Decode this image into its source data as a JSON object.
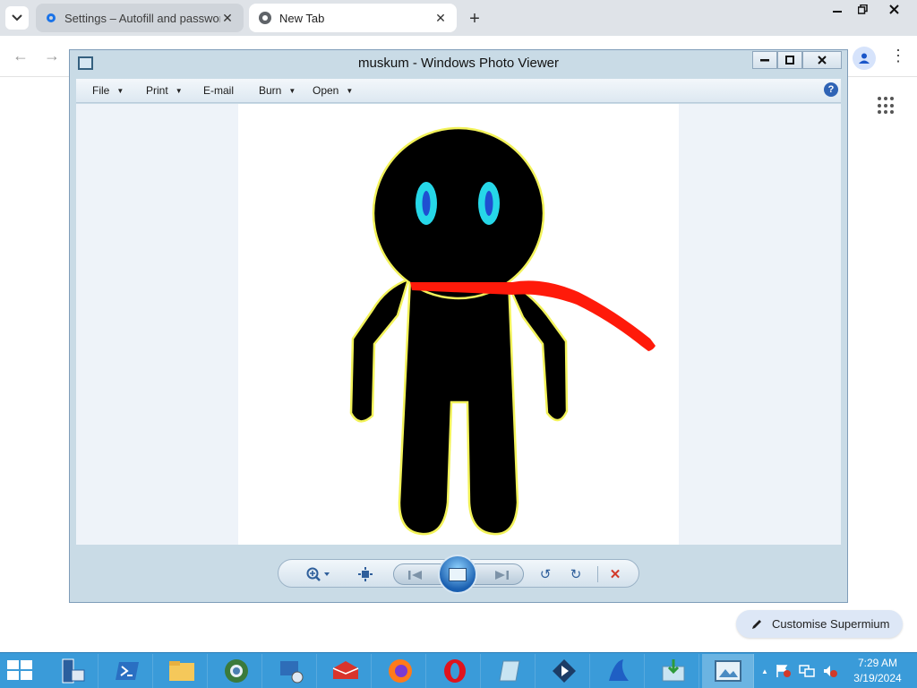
{
  "browser": {
    "tabs": [
      {
        "title": "Settings – Autofill and passwords",
        "active": false
      },
      {
        "title": "New Tab",
        "active": true
      }
    ],
    "tab_close_glyph": "✕",
    "new_tab_glyph": "+",
    "window_controls": {
      "minimize": "—",
      "restore": "❐",
      "close": "✕"
    }
  },
  "photo_viewer": {
    "title": "muskum - Windows Photo Viewer",
    "menu": [
      {
        "label": "File",
        "has_dropdown": true
      },
      {
        "label": "Print",
        "has_dropdown": true
      },
      {
        "label": "E-mail",
        "has_dropdown": false
      },
      {
        "label": "Burn",
        "has_dropdown": true
      },
      {
        "label": "Open",
        "has_dropdown": true
      }
    ],
    "help_glyph": "?",
    "window_buttons": {
      "minimize": "—",
      "maximize": "☐",
      "close": "✕"
    },
    "image": {
      "subject": "stick figure with red scarf",
      "colors": {
        "body": "#000000",
        "outline": "#f2f25a",
        "eyes": "#26d7e8",
        "pupils": "#1f4fd1",
        "scarf": "#ff1a0a"
      }
    },
    "controls": {
      "zoom_glyph": "⚲",
      "rotate_left_glyph": "↺",
      "rotate_right_glyph": "↻",
      "delete_glyph": "✕"
    }
  },
  "customise": {
    "label": "Customise Supermium"
  },
  "taskbar": {
    "apps": [
      "file-explorer",
      "powershell",
      "folder",
      "browser-globe",
      "network",
      "toolbox",
      "firefox",
      "opera",
      "notepad",
      "media",
      "shark",
      "downloads",
      "photo-viewer"
    ],
    "clock": {
      "time": "7:29 AM",
      "date": "3/19/2024"
    },
    "tray_arrow": "▲"
  },
  "colors": {
    "taskbar": "#3a9bd9",
    "viewer_frame": "#c9dbe6",
    "accent": "#2f63b5"
  }
}
